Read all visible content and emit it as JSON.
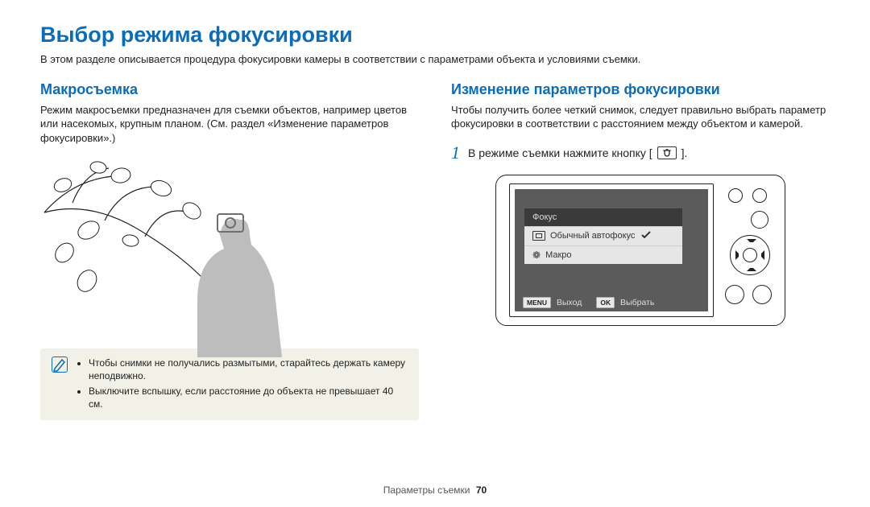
{
  "title": "Выбор режима фокусировки",
  "intro": "В этом разделе описывается процедура фокусировки камеры в соответствии с параметрами объекта и условиями съемки.",
  "left": {
    "heading": "Макросъемка",
    "body": "Режим макросъемки предназначен для съемки объектов, например цветов или насекомых, крупным планом. (См. раздел «Изменение параметров фокусировки».)",
    "notes": [
      "Чтобы снимки не получались размытыми, старайтесь держать камеру неподвижно.",
      "Выключите вспышку, если расстояние до объекта не превышает 40 см."
    ]
  },
  "right": {
    "heading": "Изменение параметров фокусировки",
    "body": "Чтобы получить более четкий снимок, следует правильно выбрать параметр фокусировки в соответствии с расстоянием между объектом и камерой.",
    "step": {
      "num": "1",
      "text_before": "В режиме съемки нажмите кнопку [",
      "text_after": "]."
    },
    "screen": {
      "menu_title": "Фокус",
      "items": [
        {
          "label": "Обычный автофокус",
          "checked": true,
          "kind": "af"
        },
        {
          "label": "Макро",
          "checked": false,
          "kind": "macro"
        }
      ],
      "footer": {
        "menu_tag": "MENU",
        "menu_label": "Выход",
        "ok_tag": "OK",
        "ok_label": "Выбрать"
      }
    }
  },
  "footer": {
    "label": "Параметры съемки",
    "page": "70"
  }
}
